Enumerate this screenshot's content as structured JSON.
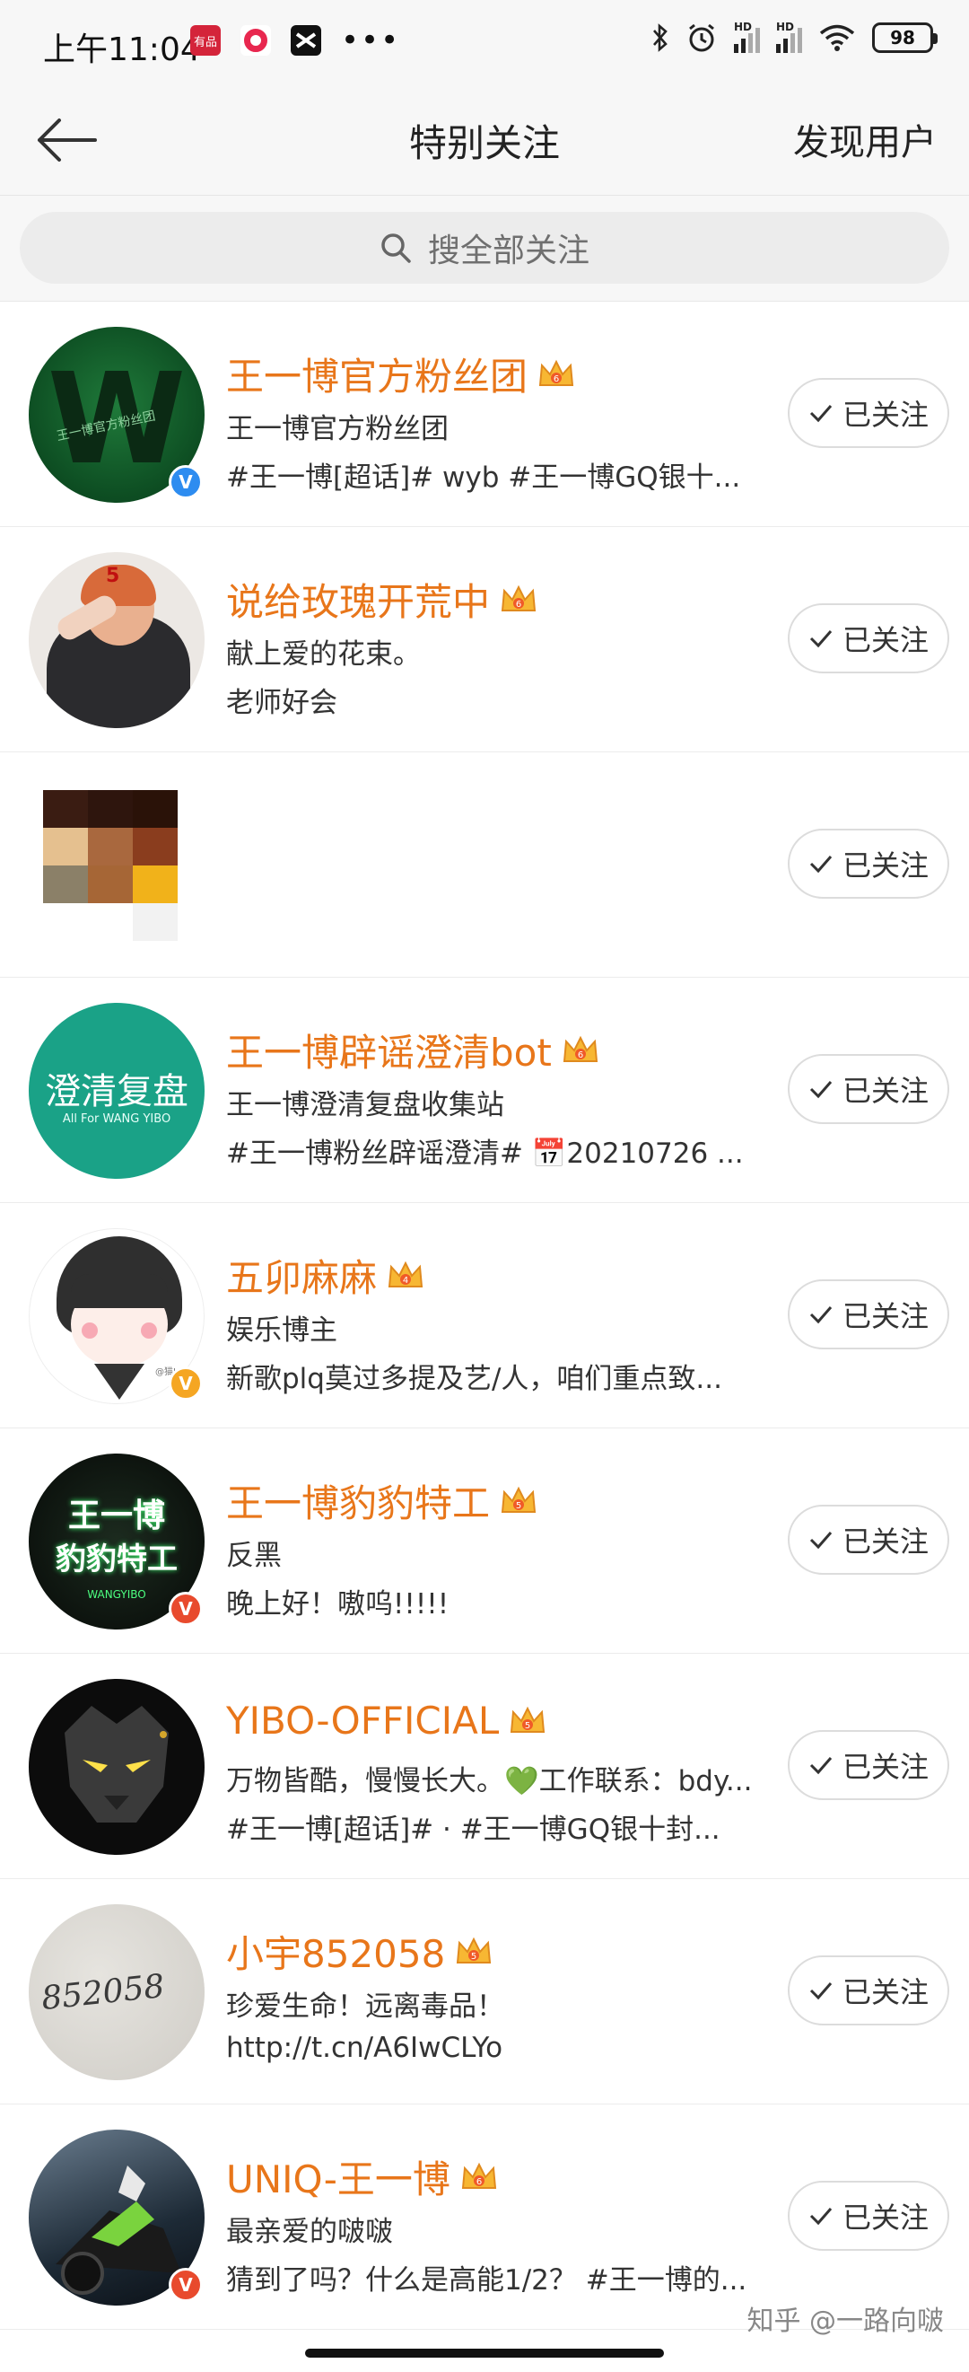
{
  "status_bar": {
    "time": "上午11:04",
    "battery": "98",
    "app_badge": "有品",
    "signal_label": "HD"
  },
  "nav": {
    "title": "特别关注",
    "right_action": "发现用户"
  },
  "search": {
    "placeholder": "搜全部关注"
  },
  "follow_label": "已关注",
  "users": [
    {
      "name": "王一博官方粉丝团",
      "desc1": "王一博官方粉丝团",
      "desc2": "#王一博[超话]# wyb #王一博GQ银十...",
      "verified": "blue",
      "crown_level": "6"
    },
    {
      "name": "说给玫瑰开荒中",
      "desc1": "献上爱的花束。",
      "desc2": "老师好会",
      "verified": "",
      "crown_level": "6"
    },
    {
      "name": "",
      "desc1": "",
      "desc2": "",
      "verified": "",
      "crown_level": ""
    },
    {
      "name": "王一博辟谣澄清bot",
      "desc1": "王一博澄清复盘收集站",
      "desc2": "#王一博粉丝辟谣澄清# 📅20210726 ...",
      "verified": "",
      "crown_level": "6"
    },
    {
      "name": "五卯麻麻",
      "desc1": "娱乐博主",
      "desc2": "新歌plq莫过多提及艺/人，咱们重点致...",
      "verified": "orange",
      "crown_level": "4"
    },
    {
      "name": "王一博豹豹特工",
      "desc1": "反黑",
      "desc2": "晚上好！嗷呜!!!!!",
      "verified": "red",
      "crown_level": "5"
    },
    {
      "name": "YIBO-OFFICIAL",
      "desc1": "万物皆酷，慢慢长大。💚工作联系：bdy...",
      "desc2": "#王一博[超话]# · #王一博GQ银十封...",
      "verified": "",
      "crown_level": "5"
    },
    {
      "name": "小宇852058",
      "desc1": "珍爱生命！远离毒品！",
      "desc2": "http://t.cn/A6IwCLYo",
      "verified": "",
      "crown_level": "5"
    },
    {
      "name": "UNIQ-王一博",
      "desc1": "最亲爱的啵啵",
      "desc2": "猜到了吗？什么是高能1/2？ #王一博的...",
      "verified": "red",
      "crown_level": "6"
    }
  ],
  "avatars": {
    "a1_letter": "W",
    "a1_small": "王一博官方粉丝团",
    "a2_number": "5",
    "a4_line1": "澄清复盘",
    "a4_line2": "All For WANG YIBO",
    "a5_tag": "@猫Lily",
    "a6_line1": "王一博",
    "a6_line2": "豹豹特工",
    "a6_line3": "WANGYIBO",
    "a8_text": "852058"
  },
  "watermark": "知乎 @一路向啵",
  "colors": {
    "accent_name": "#e8761a",
    "verified_blue": "#2d8cf0",
    "verified_orange": "#f5a623",
    "verified_red": "#e84a2d"
  }
}
